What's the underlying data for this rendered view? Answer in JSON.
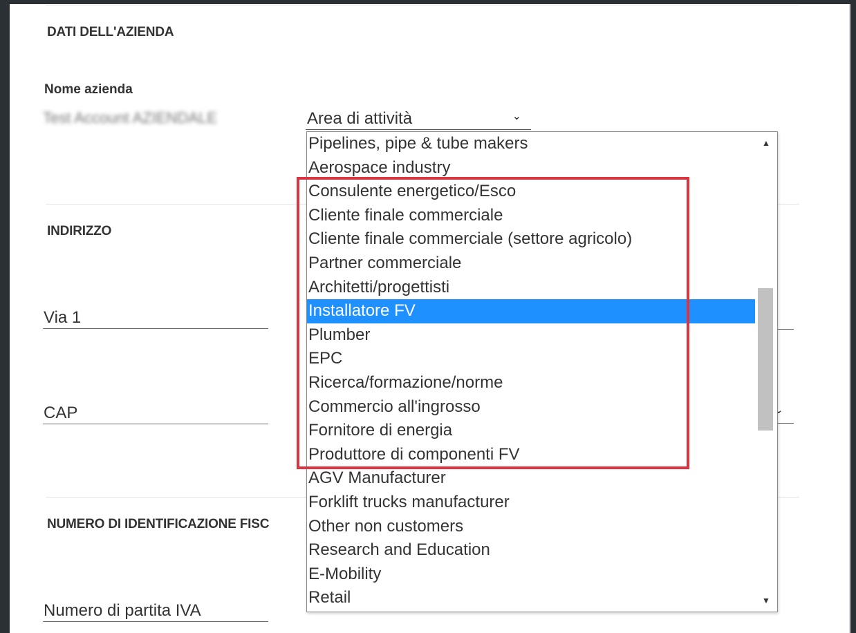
{
  "sections": {
    "company": "DATI DELL'AZIENDA",
    "address": "INDIRIZZO",
    "tax_id": "NUMERO DI IDENTIFICAZIONE FISC"
  },
  "fields": {
    "company_name_label": "Nome azienda",
    "company_name_value": "Test Account AZIENDALE",
    "street_placeholder": "Via 1",
    "zip_placeholder": "CAP",
    "vat_placeholder": "Numero di partita IVA"
  },
  "activity_select": {
    "label": "Area di attività",
    "chevron": "chevron-down-icon",
    "selected": "Installatore FV",
    "options": [
      "Pipelines, pipe & tube makers",
      "Aerospace industry",
      "Consulente energetico/Esco",
      "Cliente finale commerciale",
      "Cliente finale commerciale (settore agricolo)",
      "Partner commerciale",
      "Architetti/progettisti",
      "Installatore FV",
      "Plumber",
      "EPC",
      "Ricerca/formazione/norme",
      "Commercio all'ingrosso",
      "Fornitore di energia",
      "Produttore di componenti FV",
      "AGV Manufacturer",
      "Forklift trucks manufacturer",
      "Other non customers",
      "Research and Education",
      "E-Mobility",
      "Retail"
    ]
  },
  "colors": {
    "selection": "#1e90ff",
    "highlight": "#d9343f",
    "background": "#2b3035"
  }
}
